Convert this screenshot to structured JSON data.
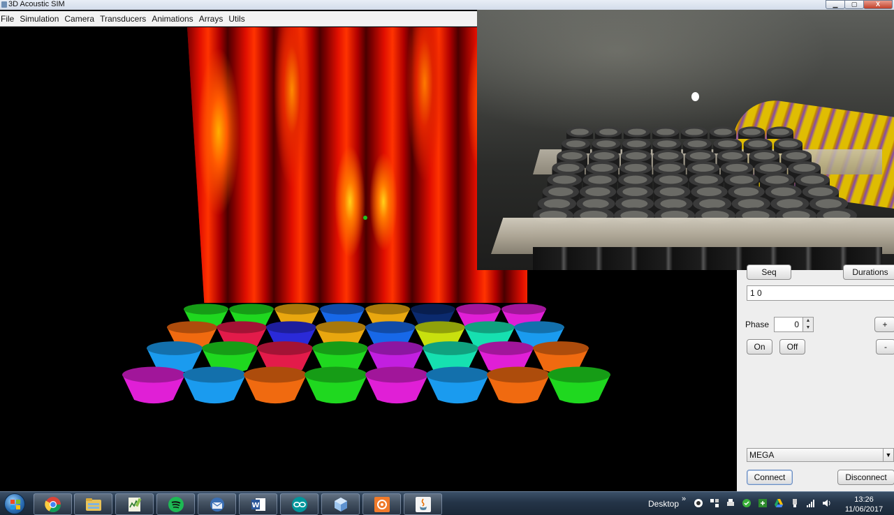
{
  "window": {
    "title": "3D Acoustic SIM",
    "controls": {
      "minimize": "▁",
      "maximize": "▢",
      "close": "X"
    }
  },
  "menu": {
    "items": [
      "File",
      "Simulation",
      "Camera",
      "Transducers",
      "Animations",
      "Arrays",
      "Utils"
    ]
  },
  "panel": {
    "seq_label": "Seq",
    "durations_label": "Durations",
    "sequence_field_value": "1 0",
    "phase_label": "Phase",
    "phase_value": "0",
    "plus_label": "+",
    "minus_label": "-",
    "on_label": "On",
    "off_label": "Off",
    "board_selected": "MEGA",
    "connect_label": "Connect",
    "disconnect_label": "Disconnect"
  },
  "transducers": {
    "rows": [
      [
        "#1fd81f",
        "#1fd81f",
        "#e9a70f",
        "#1768e8",
        "#e9a70f",
        "#0b2a6e",
        "#e01fd6",
        "#e01fd6"
      ],
      [
        "#f06a10",
        "#e31b4a",
        "#2a2ad8",
        "#e9a70f",
        "#1768e8",
        "#c8e00e",
        "#16e0b0",
        "#1a9bef"
      ],
      [
        "#1a9bef",
        "#1fd81f",
        "#e31b4a",
        "#1fd81f",
        "#c21fe0",
        "#16e0b0",
        "#e01fd6",
        "#f06a10"
      ],
      [
        "#e01fd6",
        "#1a9bef",
        "#f06a10",
        "#1fd81f",
        "#e01fd6",
        "#1a9bef",
        "#f06a10",
        "#1fd81f"
      ]
    ]
  },
  "taskbar": {
    "apps": [
      "windows-explorer",
      "chrome",
      "file-explorer",
      "sketch-app",
      "spotify",
      "thunderbird",
      "word",
      "arduino",
      "virtualbox",
      "orange-app",
      "java"
    ],
    "desktop_label": "Desktop",
    "chevron": "»",
    "time": "13:26",
    "date": "11/06/2017"
  }
}
